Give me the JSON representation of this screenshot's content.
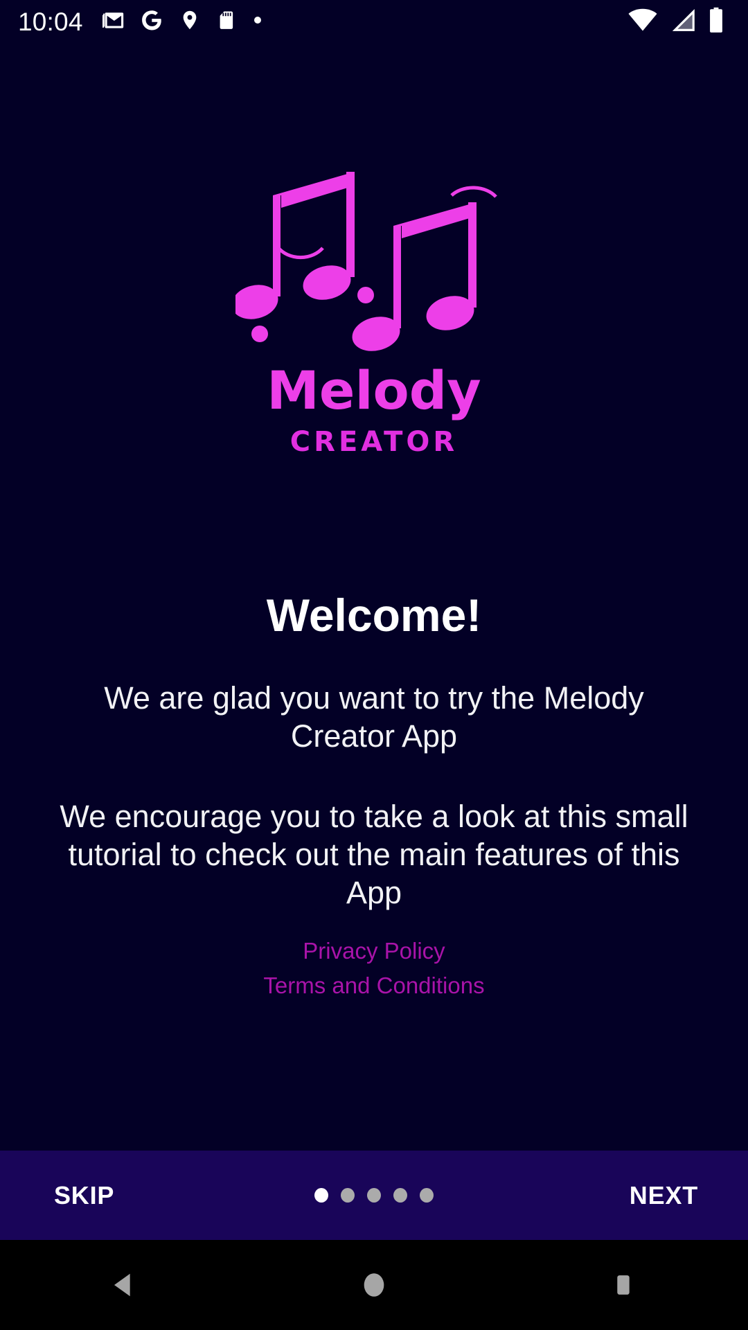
{
  "status_bar": {
    "clock": "10:04",
    "left_icons": [
      {
        "name": "gmail-icon",
        "label": "Gmail"
      },
      {
        "name": "google-icon",
        "label": "Google"
      },
      {
        "name": "location-pin-icon",
        "label": "Location"
      },
      {
        "name": "sd-card-icon",
        "label": "SD card"
      },
      {
        "name": "notification-dot-icon",
        "label": "More notifications"
      }
    ],
    "right_icons": [
      {
        "name": "wifi-icon",
        "label": "Wi-Fi"
      },
      {
        "name": "cellular-signal-icon",
        "label": "Mobile signal"
      },
      {
        "name": "battery-icon",
        "label": "Battery"
      }
    ]
  },
  "logo": {
    "mark_name": "music-notes-logo-icon",
    "wordmark": "Melody",
    "subwordmark": "CREATOR",
    "color": "#ed3fe8"
  },
  "content": {
    "title": "Welcome!",
    "paragraph_1": "We are glad you want to try the Melody Creator App",
    "paragraph_2": "We encourage you to take a look at this small tutorial to check out the main features of this App",
    "links": [
      {
        "label": "Privacy Policy",
        "name": "privacy-policy-link"
      },
      {
        "label": "Terms and Conditions",
        "name": "terms-and-conditions-link"
      }
    ],
    "link_color": "#a913a9",
    "text_color": "#ffffff"
  },
  "onboarding_bar": {
    "skip_label": "SKIP",
    "next_label": "NEXT",
    "background_color": "#190559",
    "pager": {
      "total": 5,
      "current_index": 0,
      "active_color": "#ffffff",
      "inactive_color": "#ababab"
    }
  },
  "system_nav": {
    "back_label": "Back",
    "home_label": "Home",
    "recents_label": "Recent apps",
    "icon_color": "#a6a6a6",
    "background_color": "#000000"
  }
}
